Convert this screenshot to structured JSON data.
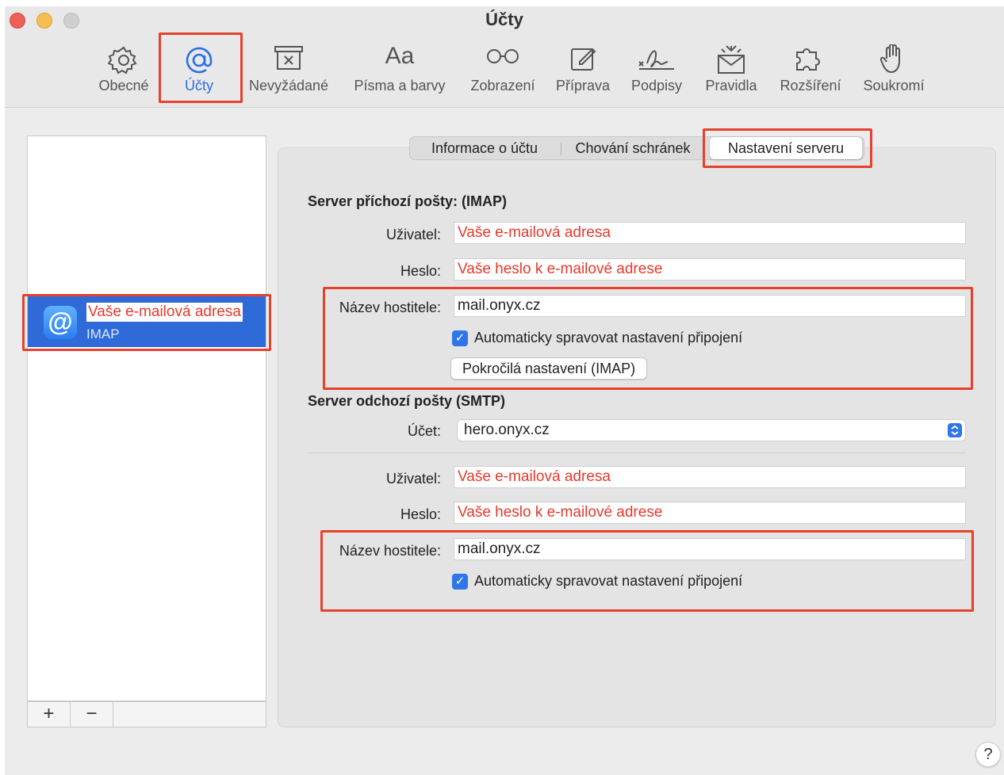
{
  "window": {
    "title": "Účty"
  },
  "toolbar": {
    "items": [
      {
        "label": "Obecné",
        "icon": "gear-icon"
      },
      {
        "label": "Účty",
        "icon": "at-icon",
        "active": true
      },
      {
        "label": "Nevyžádané",
        "icon": "junk-icon"
      },
      {
        "label": "Písma a barvy",
        "icon": "fonts-icon",
        "glyph": "Aa"
      },
      {
        "label": "Zobrazení",
        "icon": "glasses-icon"
      },
      {
        "label": "Příprava",
        "icon": "compose-icon"
      },
      {
        "label": "Podpisy",
        "icon": "signature-icon"
      },
      {
        "label": "Pravidla",
        "icon": "rules-icon"
      },
      {
        "label": "Rozšíření",
        "icon": "puzzle-icon"
      },
      {
        "label": "Soukromí",
        "icon": "hand-icon"
      }
    ]
  },
  "accounts": {
    "items": [
      {
        "name": "Vaše e-mailová adresa",
        "type": "IMAP",
        "selected": true
      }
    ],
    "add_label": "+",
    "remove_label": "−"
  },
  "tabs": [
    {
      "label": "Informace o účtu"
    },
    {
      "label": "Chování schránek"
    },
    {
      "label": "Nastavení serveru",
      "selected": true
    }
  ],
  "incoming": {
    "title": "Server příchozí pošty: (IMAP)",
    "user_label": "Uživatel:",
    "user_value": "Vaše e-mailová adresa",
    "password_label": "Heslo:",
    "password_value": "Vaše heslo k e-mailové adrese",
    "host_label": "Název hostitele:",
    "host_value": "mail.onyx.cz",
    "auto_label": "Automaticky spravovat nastavení připojení",
    "advanced_label": "Pokročilá nastavení (IMAP)"
  },
  "outgoing": {
    "title": "Server odchozí pošty (SMTP)",
    "account_label": "Účet:",
    "account_value": "hero.onyx.cz",
    "user_label": "Uživatel:",
    "user_value": "Vaše e-mailová adresa",
    "password_label": "Heslo:",
    "password_value": "Vaše heslo k e-mailové adrese",
    "host_label": "Název hostitele:",
    "host_value": "mail.onyx.cz",
    "auto_label": "Automaticky spravovat nastavení připojení"
  },
  "help_label": "?",
  "colors": {
    "accent": "#2f6ad9",
    "highlight_box": "#e5412d",
    "placeholder_text": "#e8392c"
  }
}
